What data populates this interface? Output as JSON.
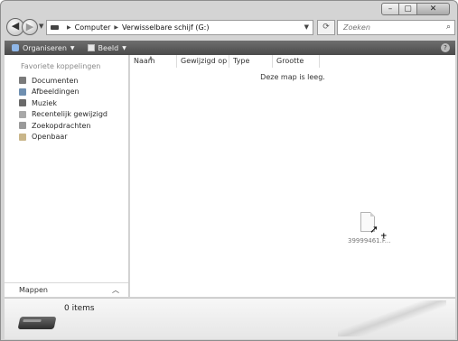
{
  "window": {
    "caption_buttons": {
      "minimize": "–",
      "maximize": "▢",
      "close": "✕"
    }
  },
  "address": {
    "breadcrumbs": [
      "Computer",
      "Verwisselbare schijf (G:)"
    ],
    "search_placeholder": "Zoeken"
  },
  "toolbar": {
    "organize_label": "Organiseren",
    "view_label": "Beeld"
  },
  "nav_pane": {
    "heading": "Favoriete koppelingen",
    "items": [
      {
        "label": "Documenten",
        "icon": "documents-icon"
      },
      {
        "label": "Afbeeldingen",
        "icon": "pictures-icon"
      },
      {
        "label": "Muziek",
        "icon": "music-icon"
      },
      {
        "label": "Recentelijk gewijzigd",
        "icon": "recent-icon"
      },
      {
        "label": "Zoekopdrachten",
        "icon": "searches-icon"
      },
      {
        "label": "Openbaar",
        "icon": "public-folder-icon"
      }
    ],
    "folders_label": "Mappen"
  },
  "content": {
    "columns": [
      "Naam",
      "Gewijzigd op",
      "Type",
      "Grootte"
    ],
    "empty_message": "Deze map is leeg.",
    "dragged_file_name": "39999461.F..."
  },
  "details": {
    "items_count": "0 items"
  },
  "colors": {
    "toolbar": "#555555",
    "window_frame": "#d4d4d4"
  }
}
